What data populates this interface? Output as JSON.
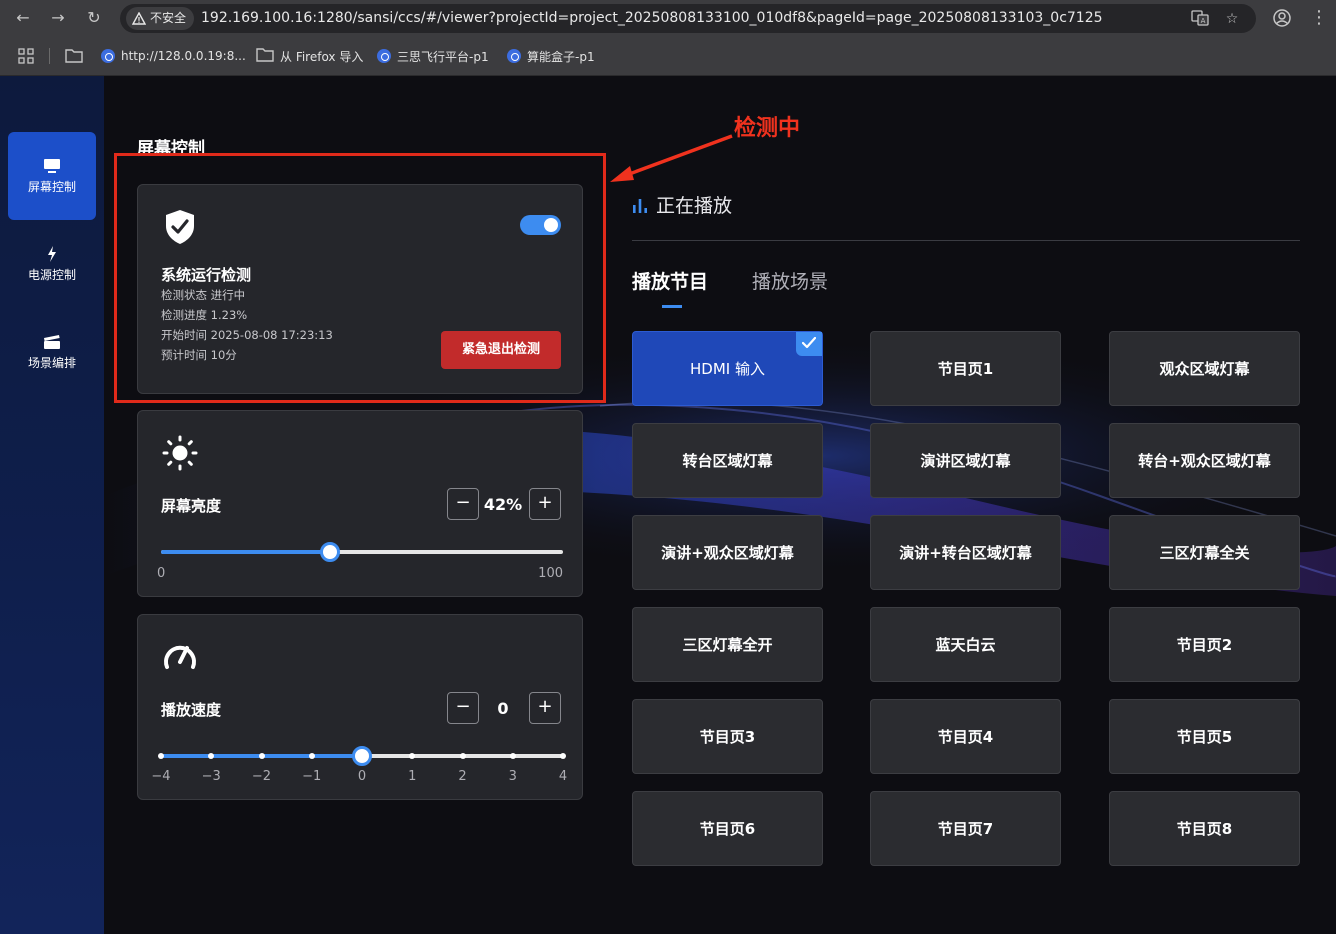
{
  "browser": {
    "security_label": "不安全",
    "url": "192.169.100.16:1280/sansi/ccs/#/viewer?projectId=project_20250808133100_010df8&pageId=page_20250808133103_0c7125",
    "bookmarks": [
      "http://128.0.0.19:8...",
      "从 Firefox 导入",
      "三思飞行平台-p1",
      "算能盒子-p1"
    ]
  },
  "sidebar": {
    "items": [
      {
        "label": "屏幕控制",
        "icon": "monitor-icon",
        "active": true
      },
      {
        "label": "电源控制",
        "icon": "lightning-icon",
        "active": false
      },
      {
        "label": "场景编排",
        "icon": "clapperboard-icon",
        "active": false
      }
    ]
  },
  "section_title": "屏幕控制",
  "annotation": {
    "text": "检测中",
    "color": "#e02a1a"
  },
  "detection": {
    "title": "系统运行检测",
    "status": "检测状态 进行中",
    "progress": "检测进度 1.23%",
    "start_time": "开始时间 2025-08-08 17:23:13",
    "estimated": "预计时间 10分",
    "toggle_on": true,
    "emergency_label": "紧急退出检测"
  },
  "brightness": {
    "label": "屏幕亮度",
    "value_text": "42%",
    "value": 42,
    "min": 0,
    "max": 100,
    "min_label": "0",
    "max_label": "100",
    "minus": "−",
    "plus": "+"
  },
  "speed": {
    "label": "播放速度",
    "value_text": "0",
    "value": 0,
    "min": -4,
    "max": 4,
    "ticks": [
      "−4",
      "−3",
      "−2",
      "−1",
      "0",
      "1",
      "2",
      "3",
      "4"
    ],
    "minus": "−",
    "plus": "+"
  },
  "now_playing": "正在播放",
  "tabs": [
    {
      "label": "播放节目",
      "active": true
    },
    {
      "label": "播放场景",
      "active": false
    }
  ],
  "programs": [
    {
      "label": "HDMI 输入",
      "selected": true
    },
    {
      "label": "节目页1",
      "selected": false
    },
    {
      "label": "观众区域灯幕",
      "selected": false
    },
    {
      "label": "转台区域灯幕",
      "selected": false
    },
    {
      "label": "演讲区域灯幕",
      "selected": false
    },
    {
      "label": "转台+观众区域灯幕",
      "selected": false
    },
    {
      "label": "演讲+观众区域灯幕",
      "selected": false
    },
    {
      "label": "演讲+转台区域灯幕",
      "selected": false
    },
    {
      "label": "三区灯幕全关",
      "selected": false
    },
    {
      "label": "三区灯幕全开",
      "selected": false
    },
    {
      "label": "蓝天白云",
      "selected": false
    },
    {
      "label": "节目页2",
      "selected": false
    },
    {
      "label": "节目页3",
      "selected": false
    },
    {
      "label": "节目页4",
      "selected": false
    },
    {
      "label": "节目页5",
      "selected": false
    },
    {
      "label": "节目页6",
      "selected": false
    },
    {
      "label": "节目页7",
      "selected": false
    },
    {
      "label": "节目页8",
      "selected": false
    }
  ],
  "colors": {
    "accent": "#3d8cf0",
    "danger": "#c22b2b",
    "sidebar_active": "#1c4fc9"
  }
}
